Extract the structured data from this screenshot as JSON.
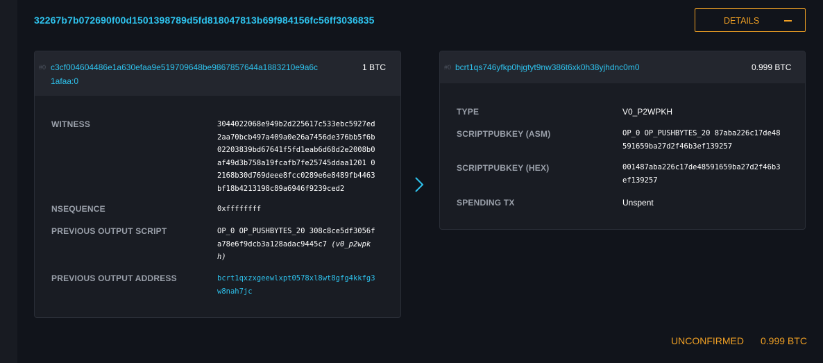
{
  "tx": {
    "txid": "32267b7b072690f00d1501398789d5fd818047813b69f984156fc56ff3036835",
    "details_label": "DETAILS"
  },
  "input": {
    "index": "#0",
    "prevout_line1": "c3cf004604486e1a630efaa9e519709648be9867857644a1883210e9a6c",
    "prevout_line2": "1afaa:0",
    "amount": "1 BTC",
    "witness_label": "WITNESS",
    "witness_lines": [
      "3044022068e949b2d225617c533ebc5927ed",
      "2aa70bcb497a409a0e26a7456de376bb5f6b",
      "02203839bd67641f5fd1eab6d68d2e2008b0",
      "af49d3b758a19fcafb7fe25745ddaa1201 0",
      "2168b30d769deee8fcc0289e6e8489fb4463",
      "bf18b4213198c89a6946f9239ced2"
    ],
    "nsequence_label": "NSEQUENCE",
    "nsequence": "0xffffffff",
    "prev_script_label": "PREVIOUS OUTPUT SCRIPT",
    "prev_script_line1": "OP_0 OP_PUSHBYTES_20 308c8ce5df3056f",
    "prev_script_line2": "a78e6f9dcb3a128adac9445c7",
    "prev_script_type_a": "(v0_p2wpk",
    "prev_script_type_b": "h)",
    "prev_addr_label": "PREVIOUS OUTPUT ADDRESS",
    "prev_addr_line1": "bcrt1qxzxgeewlxpt0578xl8wt8gfg4kkfg3",
    "prev_addr_line2": "w8nah7jc"
  },
  "output": {
    "index": "#0",
    "address": "bcrt1qs746yfkp0hjgtyt9nw386t6xk0h38yjhdnc0m0",
    "amount": "0.999 BTC",
    "type_label": "TYPE",
    "type": "V0_P2WPKH",
    "asm_label": "SCRIPTPUBKEY (ASM)",
    "asm_line1": "OP_0 OP_PUSHBYTES_20 87aba226c17de48",
    "asm_line2": "591659ba27d2f46b3ef139257",
    "hex_label": "SCRIPTPUBKEY (HEX)",
    "hex_line1": "001487aba226c17de48591659ba27d2f46b3",
    "hex_line2": "ef139257",
    "spending_label": "SPENDING TX",
    "spending": "Unspent"
  },
  "footer": {
    "status": "UNCONFIRMED",
    "total": "0.999 BTC"
  },
  "colors": {
    "accent": "#2ec3ee",
    "warning": "#f0a024",
    "background": "#11141b"
  }
}
